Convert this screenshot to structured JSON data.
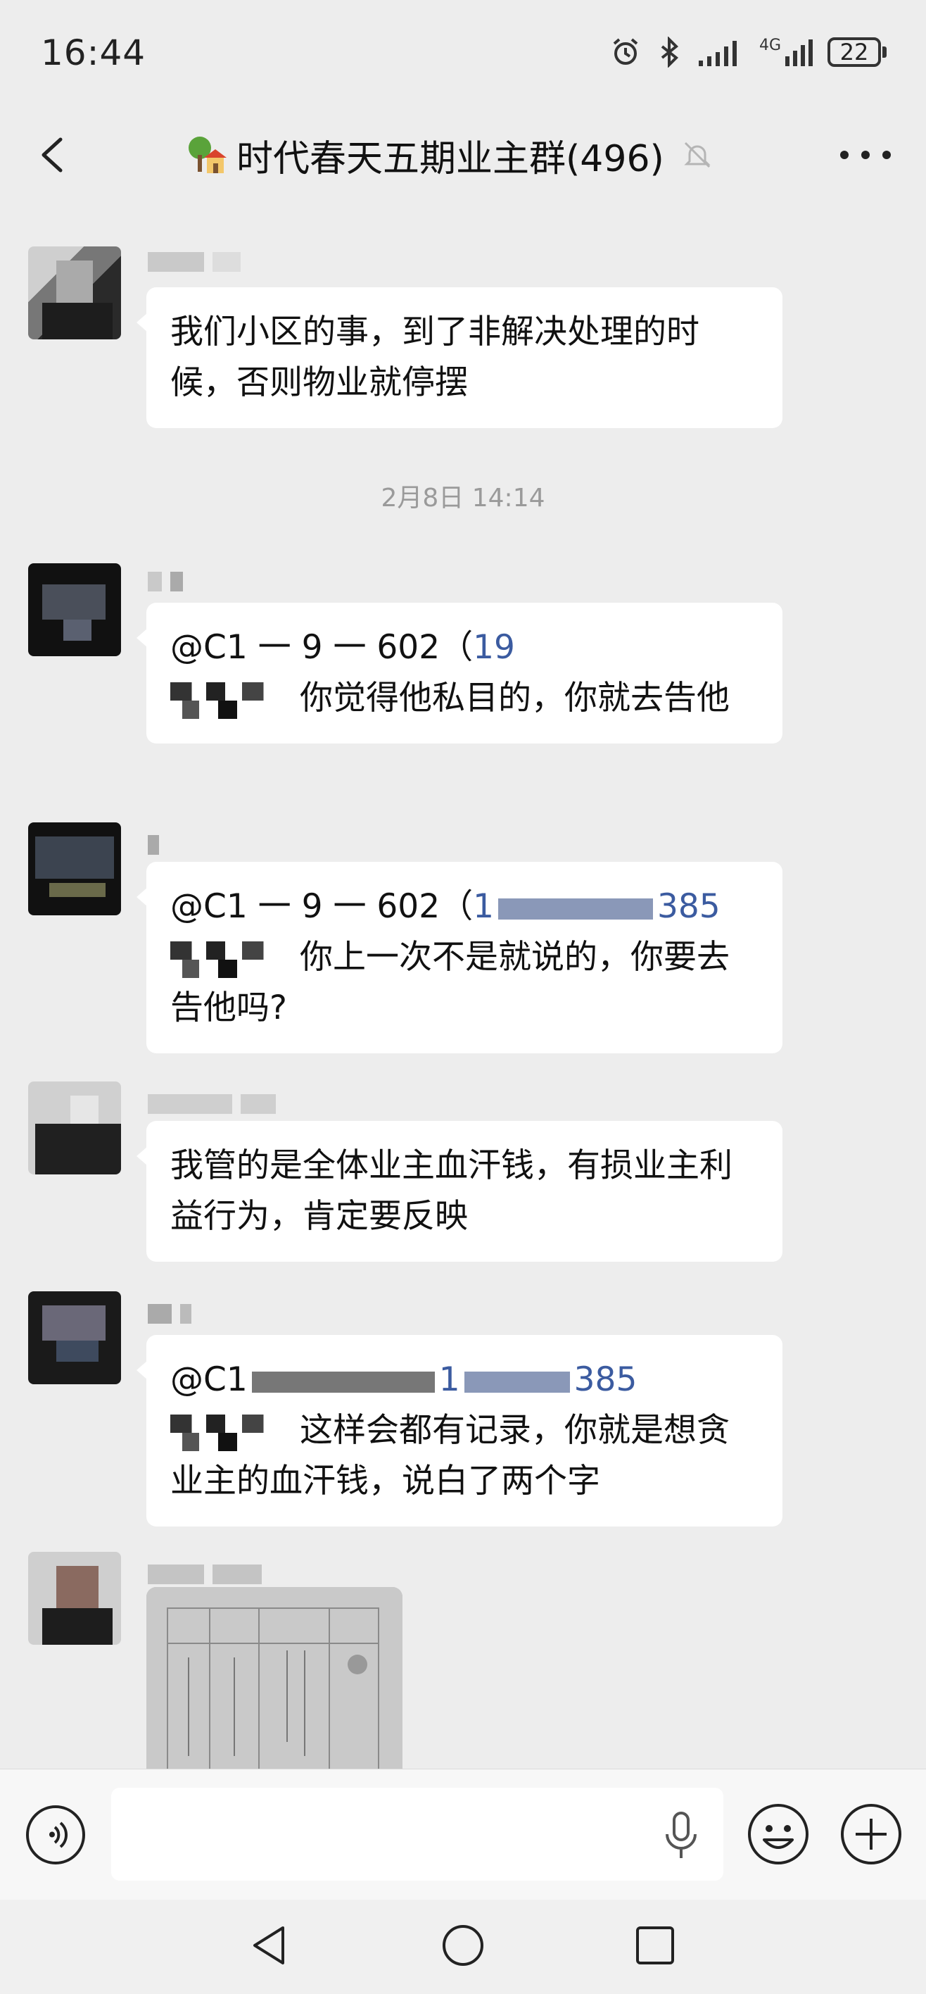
{
  "status": {
    "time": "16:44",
    "network": "4G",
    "battery": "22"
  },
  "header": {
    "title": "时代春天五期业主群(496)"
  },
  "messages": [
    {
      "text": "我们小区的事，到了非解决处理的时候，否则物业就停摆"
    },
    {
      "mention": "@C1 一 9 一 602（",
      "phone": "19",
      "text": "你觉得他私目的，你就去告他"
    },
    {
      "mention": "@C1 一 9 一 602（",
      "phone": "1",
      "phone_tail": "385",
      "text": "你上一次不是就说的，你要去告他吗?"
    },
    {
      "text": "我管的是全体业主血汗钱，有损业主利益行为，肯定要反映"
    },
    {
      "mention": "@C1",
      "phone": "1",
      "phone_tail": "385",
      "text": "这样会都有记录，你就是想贪业主的血汗钱，说白了两个字"
    }
  ],
  "time_divider": "2月8日 14:14",
  "input": {
    "placeholder": ""
  },
  "colors": {
    "background": "#ededed",
    "bubble": "#ffffff",
    "link": "#3b5ba0"
  }
}
